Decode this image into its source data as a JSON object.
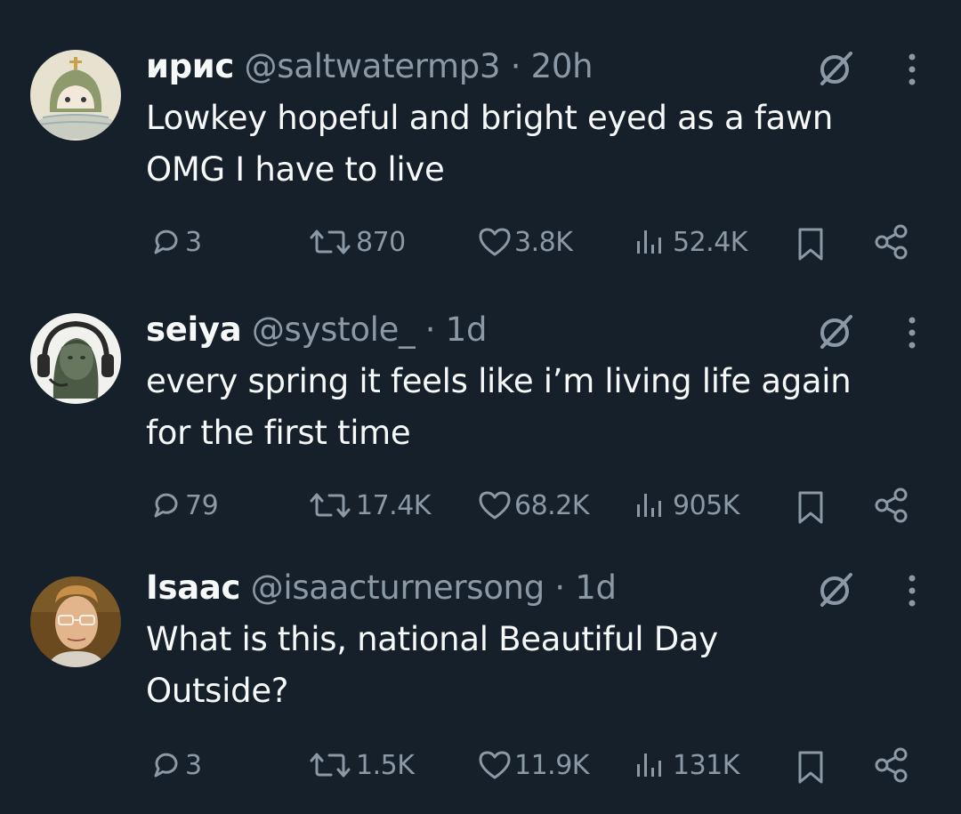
{
  "tweets": [
    {
      "name": "ирис",
      "handle": "@saltwatermp3",
      "dot": "·",
      "time": "20h",
      "lines": [
        "Lowkey hopeful and bright eyed as a fawn",
        "OMG I have to live"
      ],
      "replies": "3",
      "reposts": "870",
      "likes": "3.8K",
      "views": "52.4K"
    },
    {
      "name": "seiya",
      "handle": "@systole_",
      "dot": "·",
      "time": "1d",
      "lines": [
        "every spring it feels like i’m living life again",
        "for the first time"
      ],
      "replies": "79",
      "reposts": "17.4K",
      "likes": "68.2K",
      "views": "905K"
    },
    {
      "name": "Isaac",
      "handle": "@isaacturnersong",
      "dot": "·",
      "time": "1d",
      "lines": [
        "What is this, national Beautiful Day",
        "Outside?"
      ],
      "replies": "3",
      "reposts": "1.5K",
      "likes": "11.9K",
      "views": "131K"
    }
  ],
  "icons": {
    "grok": "grok-icon",
    "more": "more-icon",
    "reply": "reply-icon",
    "repost": "repost-icon",
    "like": "like-icon",
    "views": "views-icon",
    "bookmark": "bookmark-icon",
    "share": "share-icon"
  },
  "colors": {
    "background": "#15202b",
    "text_primary": "#f7f9f9",
    "text_secondary": "#8b98a5"
  }
}
